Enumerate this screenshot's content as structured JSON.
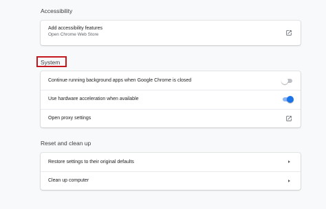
{
  "accessibility": {
    "title": "Accessibility",
    "add_features": {
      "label": "Add accessibility features",
      "sublabel": "Open Chrome Web Store"
    }
  },
  "system": {
    "title": "System",
    "background_apps": {
      "label": "Continue running background apps when Google Chrome is closed",
      "enabled": false
    },
    "hardware_accel": {
      "label": "Use hardware acceleration when available",
      "enabled": true
    },
    "proxy": {
      "label": "Open proxy settings"
    }
  },
  "reset": {
    "title": "Reset and clean up",
    "restore": {
      "label": "Restore settings to their original defaults"
    },
    "cleanup": {
      "label": "Clean up computer"
    }
  },
  "colors": {
    "accent": "#1a73e8",
    "highlight_box": "#c4161c"
  },
  "icons": {
    "external_link": "external-link-icon",
    "arrow_right": "arrow-right-icon"
  }
}
